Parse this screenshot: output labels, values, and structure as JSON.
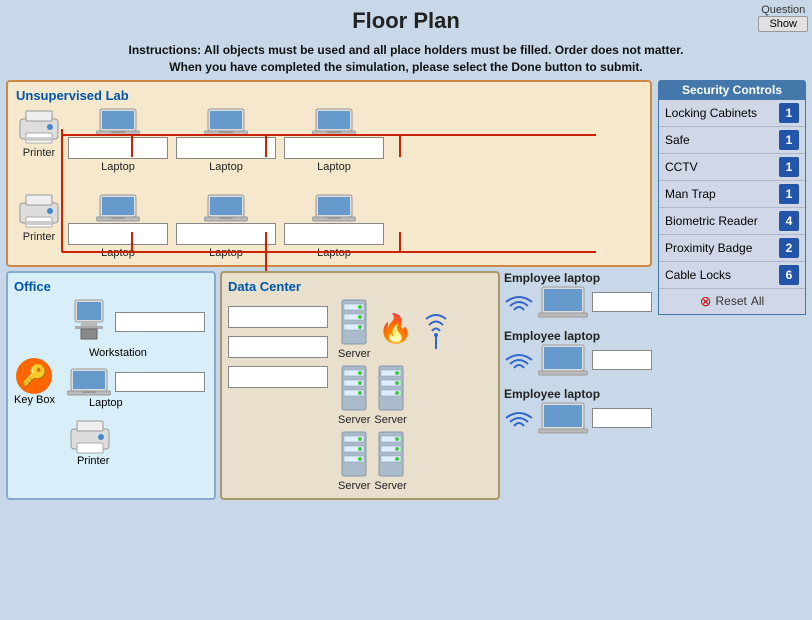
{
  "header": {
    "title": "Floor Plan",
    "instructions_line1": "Instructions: All objects must be used and all place holders must be filled. Order does not matter.",
    "instructions_line2": "When you have completed the simulation, please select the Done button to submit."
  },
  "question_button": {
    "label": "Question",
    "show_label": "Show"
  },
  "security_controls": {
    "panel_title": "Security Controls",
    "items": [
      {
        "name": "Locking Cabinets",
        "count": "1"
      },
      {
        "name": "Safe",
        "count": "1"
      },
      {
        "name": "CCTV",
        "count": "1"
      },
      {
        "name": "Man Trap",
        "count": "1"
      },
      {
        "name": "Biometric Reader",
        "count": "4"
      },
      {
        "name": "Proximity Badge",
        "count": "2"
      },
      {
        "name": "Cable Locks",
        "count": "6"
      }
    ],
    "reset_label": "Reset",
    "all_label": "All"
  },
  "lab": {
    "label": "Unsupervised Lab",
    "row1": {
      "devices": [
        "Printer",
        "Laptop",
        "Laptop",
        "Laptop"
      ]
    },
    "row2": {
      "devices": [
        "Printer",
        "Laptop",
        "Laptop",
        "Laptop"
      ]
    }
  },
  "office": {
    "label": "Office",
    "devices": [
      "Workstation",
      "Laptop",
      "Printer",
      "Key Box"
    ]
  },
  "datacenter": {
    "label": "Data Center",
    "servers": [
      "Server",
      "Server",
      "Server",
      "Server"
    ]
  },
  "employee_laptops": {
    "items": [
      {
        "label": "Employee laptop"
      },
      {
        "label": "Employee laptop"
      },
      {
        "label": "Employee laptop"
      }
    ]
  }
}
